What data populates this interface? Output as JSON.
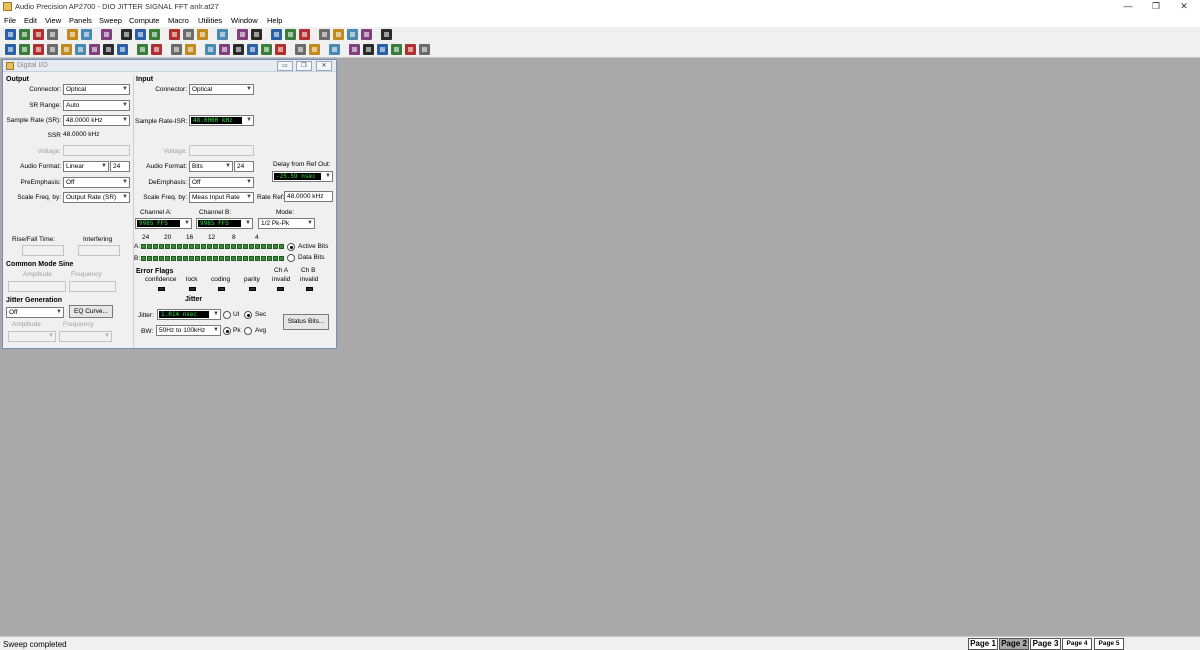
{
  "app": {
    "title": "Audio Precision AP2700 - DIO JITTER SIGNAL FFT anlr.at27",
    "menus": [
      "File",
      "Edit",
      "View",
      "Panels",
      "Sweep",
      "Compute",
      "Macro",
      "Utilities",
      "Window",
      "Help"
    ],
    "window_controls": {
      "minimize": "—",
      "restore": "❐",
      "close": "✕"
    }
  },
  "toolbar": {
    "row1_icons": [
      "new-icon",
      "open-icon",
      "save-icon",
      "save-all-icon",
      "print-icon",
      "print-preview-icon",
      "undo-icon",
      "cut-icon",
      "copy-icon",
      "paste-icon",
      "go-icon",
      "stop-circle-icon",
      "record-icon",
      "sweep-icon",
      "display-icon",
      "link-icon",
      "play-icon",
      "pause-icon",
      "stop-icon",
      "hand-icon",
      "glasses-icon",
      "rename-icon",
      "tile-icon",
      "cascade-icon"
    ],
    "row2_icons": [
      "analyzer-icon",
      "antenna-icon",
      "filter-icon",
      "gen-icon",
      "dio-icon",
      "switcher-icon",
      "fft-icon",
      "meter-icon",
      "speaker-icon",
      "bits-icon",
      "check-icon",
      "tree-icon",
      "grid-icon",
      "arrow-right-icon",
      "arrow-down-icon",
      "chart-icon",
      "table-icon",
      "graph-icon",
      "tower-icon",
      "ruler-icon",
      "monitor1-icon",
      "monitor2-icon",
      "monitor3-icon",
      "monitor4-icon",
      "monitor5-icon",
      "monitor6-icon",
      "monitor7-icon",
      "monitor8-icon"
    ]
  },
  "panel": {
    "title": "Digital I/O",
    "buttons": {
      "minimize": "▭",
      "restore": "❐",
      "close": "✕"
    },
    "output": {
      "header": "Output",
      "connector_label": "Connector:",
      "connector": "Optical",
      "sr_range_label": "SR Range:",
      "sr_range": "Auto",
      "sample_rate_label": "Sample Rate (SR):",
      "sample_rate": "48.0000 kHz",
      "ssr_label": "SSR",
      "ssr": "48.0000 kHz",
      "voltage_label": "Voltage:",
      "audio_format_label": "Audio Format:",
      "audio_format": "Linear",
      "audio_bits": "24",
      "preemphasis_label": "PreEmphasis:",
      "preemphasis": "Off",
      "scale_freq_label": "Scale Freq. by:",
      "scale_freq": "Output Rate (SR)",
      "rise_fall_label": "Rise/Fall Time:",
      "interfering_label": "Interfering"
    },
    "common_mode": {
      "header": "Common Mode Sine",
      "amplitude_label": "Amplitude",
      "frequency_label": "Frequency"
    },
    "jitter_gen": {
      "header": "Jitter Generation",
      "mode": "Off",
      "eq_button": "EQ Curve...",
      "amplitude_label": "Amplitude",
      "frequency_label": "Frequency"
    },
    "input": {
      "header": "Input",
      "connector_label": "Connector:",
      "connector": "Optical",
      "sample_rate_label": "Sample Rate-ISR:",
      "sample_rate": "48.0000 kHz",
      "voltage_label": "Voltage:",
      "audio_format_label": "Audio Format:",
      "audio_format": "Bits",
      "audio_bits": "24",
      "deemphasis_label": "DeEmphasis:",
      "deemphasis": "Off",
      "scale_freq_label": "Scale Freq. by:",
      "scale_freq": "Meas Input Rate",
      "rate_ref_label": "Rate Ref:",
      "rate_ref": "48.0000 kHz",
      "delay_label": "Delay from Ref Out:",
      "delay": "-25.59 nsec",
      "channel_a_label": "Channel A:",
      "channel_a": "9985  FFS",
      "channel_b_label": "Channel B:",
      "channel_b": "9985  FFS",
      "mode_label": "Mode:",
      "mode": "1/2 Pk-Pk",
      "bit_scale": [
        "24",
        "20",
        "16",
        "12",
        "8",
        "4"
      ],
      "bits_a_label": "A:",
      "bits_b_label": "B:",
      "active_bits": "Active Bits",
      "data_bits": "Data Bits",
      "error_flags_header": "Error Flags",
      "flags": [
        "confidence",
        "lock",
        "coding",
        "parity",
        "invalid",
        "invalid"
      ],
      "flag_ch_a": "Ch A",
      "flag_ch_b": "Ch B"
    },
    "jitter": {
      "header": "Jitter",
      "jitter_label": "Jitter:",
      "jitter": "1.014  nsec",
      "ui": "UI",
      "sec": "Sec",
      "bw_label": "BW:",
      "bw": "50Hz to 100kHz",
      "pk": "Pk",
      "avg": "Avg",
      "status_button": "Status Bits..."
    }
  },
  "status": {
    "text": "Sweep completed",
    "pages": [
      "Page 1",
      "Page 2",
      "Page 3",
      "Page 4",
      "Page 5"
    ],
    "active_page": "Page 2"
  },
  "colors": {
    "accent": "#2fe04a",
    "bit_led": "#3c8c3c",
    "workspace": "#a9a9a9"
  }
}
